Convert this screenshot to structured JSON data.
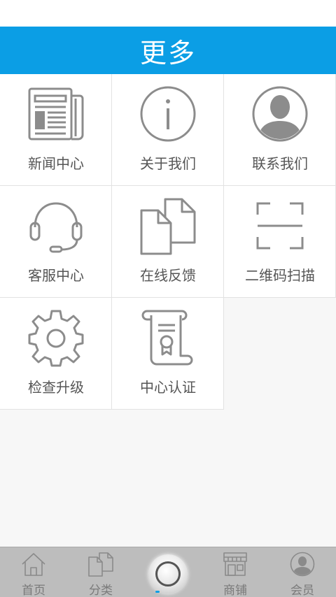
{
  "header": {
    "title": "更多"
  },
  "grid": {
    "items": [
      {
        "label": "新闻中心",
        "icon": "newspaper-icon"
      },
      {
        "label": "关于我们",
        "icon": "info-icon"
      },
      {
        "label": "联系我们",
        "icon": "person-avatar-icon"
      },
      {
        "label": "客服中心",
        "icon": "headset-icon"
      },
      {
        "label": "在线反馈",
        "icon": "documents-icon"
      },
      {
        "label": "二维码扫描",
        "icon": "scan-frame-icon"
      },
      {
        "label": "检查升级",
        "icon": "gear-icon"
      },
      {
        "label": "中心认证",
        "icon": "certificate-scroll-icon"
      }
    ]
  },
  "tabbar": {
    "tabs": [
      {
        "label": "首页",
        "icon": "home-icon"
      },
      {
        "label": "分类",
        "icon": "category-icon"
      },
      {
        "label": "",
        "icon": "center-round-button"
      },
      {
        "label": "商铺",
        "icon": "store-icon"
      },
      {
        "label": "会员",
        "icon": "member-avatar-icon"
      }
    ]
  },
  "colors": {
    "header_bg": "#0b9ee5",
    "icon_gray": "#8c8c8c",
    "label_gray": "#555555",
    "tabbar_bg": "#bdbdbd"
  }
}
